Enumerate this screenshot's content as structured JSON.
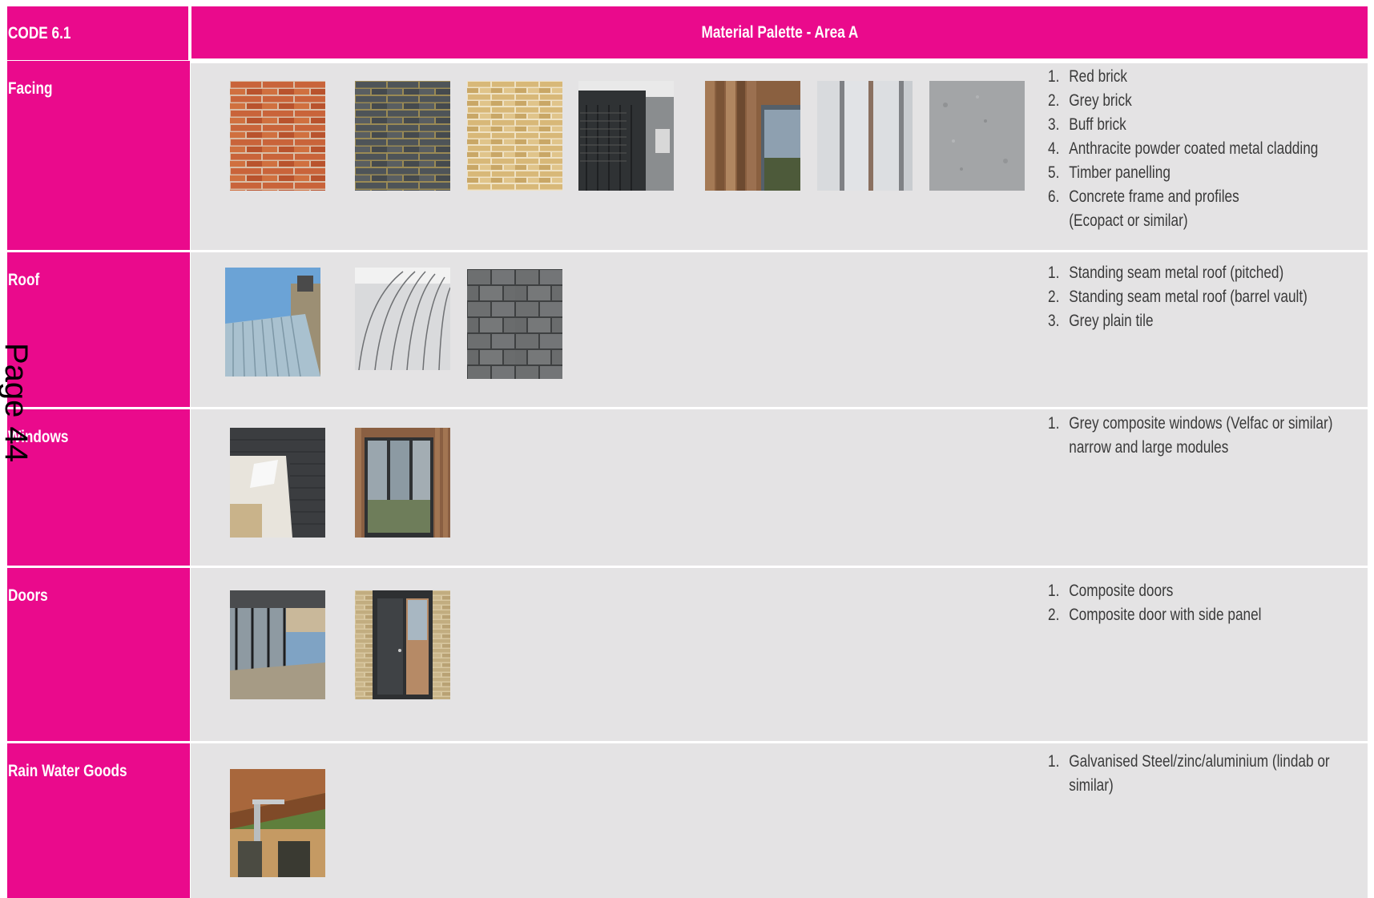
{
  "header": {
    "code": "CODE 6.1",
    "title": "Material Palette - Area A"
  },
  "page_number": "Page 44",
  "rows": [
    {
      "label": "Facing",
      "items": [
        "Red brick",
        "Grey brick",
        "Buff brick",
        "Anthracite powder coated metal cladding",
        "Timber panelling",
        "Concrete frame and profiles (Ecopact or similar)"
      ]
    },
    {
      "label": "Roof",
      "items": [
        "Standing seam metal roof (pitched)",
        "Standing seam metal roof (barrel vault)",
        "Grey plain tile"
      ]
    },
    {
      "label": "Windows",
      "items": [
        "Grey composite windows (Velfac or similar) narrow and large modules"
      ]
    },
    {
      "label": "Doors",
      "items": [
        "Composite doors",
        "Composite door with side panel"
      ]
    },
    {
      "label": "Rain Water Goods",
      "items": [
        "Galvanised Steel/zinc/aluminium (lindab or similar)"
      ]
    }
  ],
  "numbers": [
    "1.",
    "2.",
    "3.",
    "4.",
    "5.",
    "6."
  ],
  "colors": {
    "accent": "#ea0a8c",
    "panel": "#e4e3e4",
    "text": "#3a3a3a"
  },
  "swatch_icons": [
    "red-brick",
    "grey-brick",
    "buff-brick",
    "anthracite-cladding",
    "timber-panelling",
    "concrete-profile",
    "concrete-texture",
    "pitched-metal-roof",
    "barrel-vault-roof",
    "grey-plain-tile",
    "window-corner",
    "window-large",
    "door-glazed",
    "door-side-panel",
    "rainwater-gutter"
  ]
}
